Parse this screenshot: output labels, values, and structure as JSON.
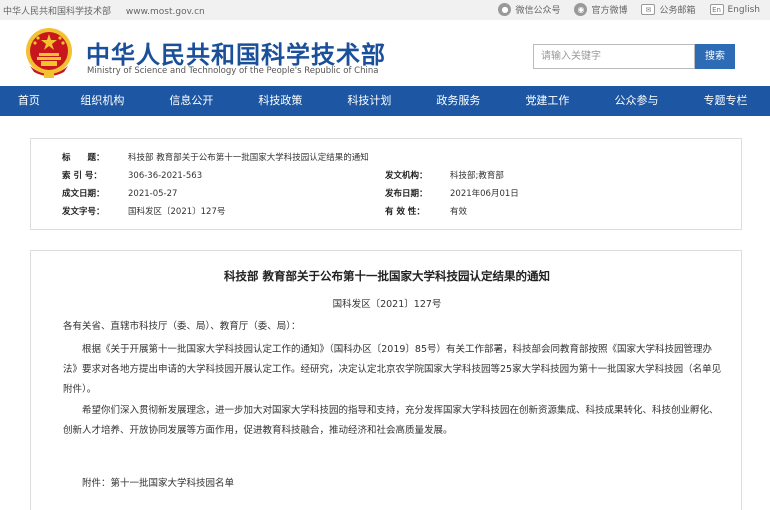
{
  "topbar": {
    "site_name": "中华人民共和国科学技术部",
    "url": "www.most.gov.cn",
    "links": [
      {
        "icon": "wechat-icon",
        "label": "微信公众号"
      },
      {
        "icon": "weibo-icon",
        "label": "官方微博"
      },
      {
        "icon": "mail-icon",
        "label": "公务邮箱"
      },
      {
        "icon": "english-icon",
        "label": "English",
        "badge": "En"
      }
    ]
  },
  "header": {
    "title": "中华人民共和国科学技术部",
    "subtitle": "Ministry of Science and Technology of the People's Republic of China",
    "search_placeholder": "请输入关键字",
    "search_button": "搜索"
  },
  "nav": [
    "首页",
    "组织机构",
    "信息公开",
    "科技政策",
    "科技计划",
    "政务服务",
    "党建工作",
    "公众参与",
    "专题专栏"
  ],
  "info": {
    "title_label": "标　　题：",
    "title_value": "科技部 教育部关于公布第十一批国家大学科技园认定结果的通知",
    "index_label": "索 引 号：",
    "index_value": "306-36-2021-563",
    "issuer_label": "发文机构：",
    "issuer_value": "科技部;教育部",
    "date_label": "成文日期：",
    "date_value": "2021-05-27",
    "pub_label": "发布日期：",
    "pub_value": "2021年06月01日",
    "doc_label": "发文字号：",
    "doc_value": "国科发区〔2021〕127号",
    "valid_label": "有 效 性：",
    "valid_value": "有效"
  },
  "content": {
    "title": "科技部 教育部关于公布第十一批国家大学科技园认定结果的通知",
    "doc_no": "国科发区〔2021〕127号",
    "greeting": "各有关省、直辖市科技厅（委、局）、教育厅（委、局）：",
    "para1": "根据《关于开展第十一批国家大学科技园认定工作的通知》（国科办区〔2019〕85号）有关工作部署，科技部会同教育部按照《国家大学科技园管理办法》要求对各地方提出申请的大学科技园开展认定工作。经研究，决定认定北京农学院国家大学科技园等25家大学科技园为第十一批国家大学科技园（名单见附件）。",
    "para2": "希望你们深入贯彻新发展理念，进一步加大对国家大学科技园的指导和支持，充分发挥国家大学科技园在创新资源集成、科技成果转化、科技创业孵化、创新人才培养、开放协同发展等方面作用，促进教育科技融合，推动经济和社会高质量发展。",
    "attachment": "附件：第十一批国家大学科技园名单"
  },
  "colors": {
    "brand_blue": "#1d57a3",
    "title_blue": "#1a4f9a",
    "emblem_red": "#c8161d",
    "emblem_gold": "#f2c230"
  }
}
